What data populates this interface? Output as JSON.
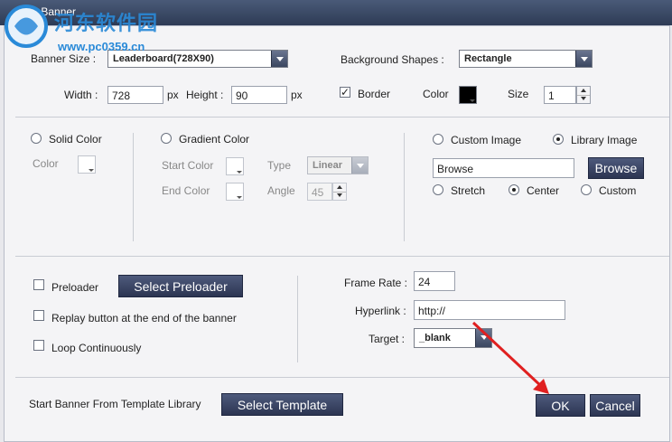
{
  "window": {
    "title": "New Banner"
  },
  "watermark": {
    "name": "河东软件园",
    "url": "www.pc0359.cn"
  },
  "banner": {
    "size_label": "Banner Size :",
    "size_value": "Leaderboard(728X90)",
    "bg_shapes_label": "Background Shapes :",
    "bg_shapes_value": "Rectangle",
    "width_label": "Width :",
    "width_value": "728",
    "width_unit": "px",
    "height_label": "Height :",
    "height_value": "90",
    "height_unit": "px",
    "border_label": "Border",
    "border_checked": true,
    "color_label": "Color",
    "color_value": "#000000",
    "size_num_label": "Size",
    "size_num_value": "1"
  },
  "fill": {
    "solid_label": "Solid Color",
    "solid_color_label": "Color",
    "gradient_label": "Gradient Color",
    "start_color_label": "Start Color",
    "end_color_label": "End Color",
    "type_label": "Type",
    "type_value": "Linear",
    "angle_label": "Angle",
    "angle_value": "45"
  },
  "image": {
    "custom_label": "Custom Image",
    "library_label": "Library Image",
    "selected": "Library Image",
    "path_value": "Browse",
    "browse_button": "Browse",
    "stretch_label": "Stretch",
    "center_label": "Center",
    "custom_pos_label": "Custom",
    "position_selected": "Center"
  },
  "options": {
    "preloader_label": "Preloader",
    "select_preloader_button": "Select Preloader",
    "replay_label": "Replay button at the end of the banner",
    "loop_label": "Loop Continuously",
    "frame_rate_label": "Frame Rate :",
    "frame_rate_value": "24",
    "hyperlink_label": "Hyperlink :",
    "hyperlink_value": "http://",
    "target_label": "Target :",
    "target_value": "_blank"
  },
  "footer": {
    "template_label": "Start Banner From Template Library",
    "select_template_button": "Select Template",
    "ok_button": "OK",
    "cancel_button": "Cancel"
  },
  "colors": {
    "accent": "#2c3552",
    "arrow": "#e02020"
  }
}
